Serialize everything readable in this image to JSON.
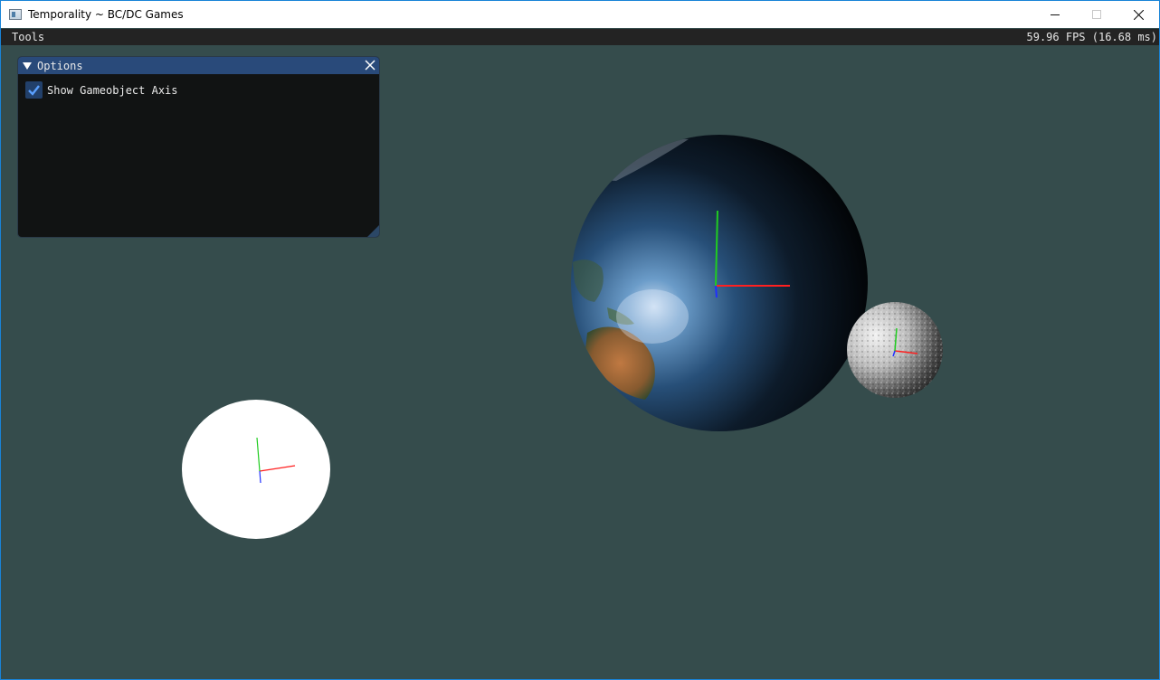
{
  "window": {
    "title": "Temporality ~ BC/DC Games",
    "minimize_icon": "minimize-icon",
    "maximize_icon": "maximize-icon",
    "close_icon": "close-icon"
  },
  "menubar": {
    "tools_label": "Tools",
    "fps_text": "59.96 FPS (16.68 ms)"
  },
  "options_panel": {
    "title": "Options",
    "collapse_icon": "triangle-down-icon",
    "close_icon": "close-icon",
    "checkbox_label": "Show Gameobject Axis",
    "checkbox_checked": true
  },
  "scene": {
    "background_color": "#354c4c",
    "objects": [
      "earth-sphere",
      "moon-sphere",
      "white-sphere"
    ],
    "axis_colors": {
      "x": "#ff2a2a",
      "y": "#22dd22",
      "z": "#2233ff"
    }
  }
}
